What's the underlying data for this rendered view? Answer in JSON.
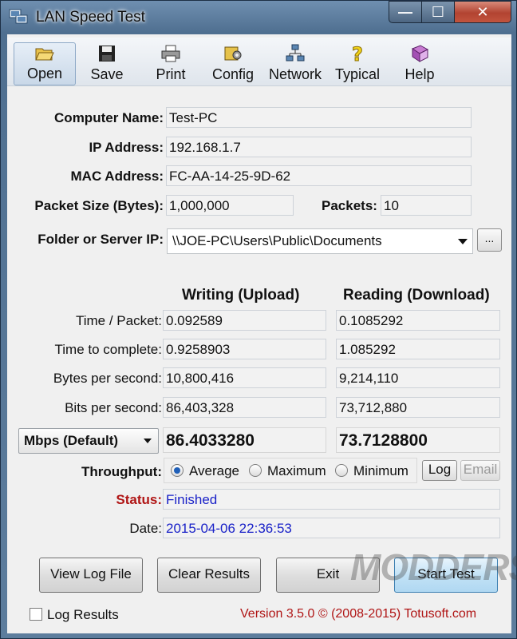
{
  "window": {
    "title": "LAN Speed Test",
    "minimize": "—",
    "maximize": "☐",
    "close": "✕"
  },
  "toolbar": [
    {
      "label": "Open",
      "icon": "open-folder-icon"
    },
    {
      "label": "Save",
      "icon": "floppy-disk-icon"
    },
    {
      "label": "Print",
      "icon": "printer-icon"
    },
    {
      "label": "Config",
      "icon": "config-icon"
    },
    {
      "label": "Network",
      "icon": "network-icon"
    },
    {
      "label": "Typical",
      "icon": "help-question-icon"
    },
    {
      "label": "Help",
      "icon": "help-book-icon"
    }
  ],
  "info": {
    "computer_name_label": "Computer Name:",
    "computer_name": "Test-PC",
    "ip_label": "IP Address:",
    "ip": "192.168.1.7",
    "mac_label": "MAC Address:",
    "mac": "FC-AA-14-25-9D-62",
    "packet_size_label": "Packet Size (Bytes):",
    "packet_size": "1,000,000",
    "packets_label": "Packets:",
    "packets": "10",
    "folder_label": "Folder or Server IP:",
    "folder": "\\\\JOE-PC\\Users\\Public\\Documents",
    "browse": "..."
  },
  "results": {
    "writing_header": "Writing (Upload)",
    "reading_header": "Reading (Download)",
    "rows": [
      {
        "label": "Time / Packet:",
        "write": "0.092589",
        "read": "0.1085292"
      },
      {
        "label": "Time to complete:",
        "write": "0.9258903",
        "read": "1.085292"
      },
      {
        "label": "Bytes per second:",
        "write": "10,800,416",
        "read": "9,214,110"
      },
      {
        "label": "Bits per second:",
        "write": "86,403,328",
        "read": "73,712,880"
      }
    ],
    "units": "Mbps (Default)",
    "write_total": "86.4033280",
    "read_total": "73.7128800"
  },
  "throughput": {
    "label": "Throughput:",
    "options": [
      "Average",
      "Maximum",
      "Minimum"
    ],
    "selected": "Average",
    "log_button": "Log",
    "email_button": "Email"
  },
  "status": {
    "label": "Status:",
    "value": "Finished"
  },
  "date": {
    "label": "Date:",
    "value": "2015-04-06 22:36:53"
  },
  "buttons": {
    "view_log": "View Log File",
    "clear": "Clear Results",
    "exit": "Exit",
    "start": "Start Test"
  },
  "footer": {
    "log_results": "Log Results",
    "version": "Version 3.5.0  ©  (2008-2015) Totusoft.com"
  },
  "watermark": "MODDERS"
}
